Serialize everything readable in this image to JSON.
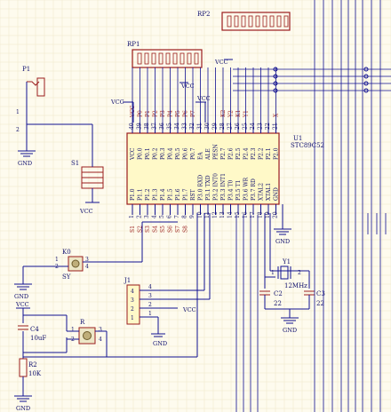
{
  "labels": {
    "rp2": "RP2",
    "rp1": "RP1",
    "vcc_rp1": "VCC",
    "vcc_rp2": "VCC",
    "vcc_u1_left": "VCC",
    "vcc_u1_top": "VCC",
    "vcc_s1": "VCC",
    "vcc_c4": "VCC",
    "vcc_j1": "VCC",
    "p1": "P1",
    "gnd_p1": "GND",
    "s1": "S1",
    "u1_ref": "U1",
    "u1_part": "STC89C52",
    "gnd_u1": "GND",
    "k0": "K0",
    "k0_val": "SY",
    "gnd_k0": "GND",
    "j1": "J1",
    "gnd_j1": "GND",
    "c4": "C4",
    "c4_val": "10uF",
    "r_ref": "R",
    "r2": "R2",
    "r2_val": "10K",
    "gnd_r2": "GND",
    "y1": "Y1",
    "y1_val": "12MHz",
    "c2": "C2",
    "c2_val": "22",
    "c3": "C3",
    "c3_val": "22",
    "gnd_xtal": "GND"
  },
  "u1_top_pins": [
    {
      "num": "40",
      "name": "VCC"
    },
    {
      "num": "39",
      "name": "P0.0"
    },
    {
      "num": "38",
      "name": "P0.1"
    },
    {
      "num": "37",
      "name": "P0.2"
    },
    {
      "num": "36",
      "name": "P0.3"
    },
    {
      "num": "35",
      "name": "P0.4"
    },
    {
      "num": "34",
      "name": "P0.5"
    },
    {
      "num": "33",
      "name": "P0.6"
    },
    {
      "num": "32",
      "name": "P0.7"
    },
    {
      "num": "31",
      "name": "EA"
    },
    {
      "num": "30",
      "name": "ALE"
    },
    {
      "num": "29",
      "name": "PESN"
    },
    {
      "num": "28",
      "name": "P2.7"
    },
    {
      "num": "27",
      "name": "P2.6"
    },
    {
      "num": "26",
      "name": "P2.5"
    },
    {
      "num": "25",
      "name": "P2.4"
    },
    {
      "num": "24",
      "name": "P2.3"
    },
    {
      "num": "23",
      "name": "P2.2"
    },
    {
      "num": "22",
      "name": "P2.1"
    },
    {
      "num": "21",
      "name": "P2.0"
    }
  ],
  "u1_bottom_pins": [
    {
      "num": "1",
      "name": "P1.0"
    },
    {
      "num": "2",
      "name": "P1.1"
    },
    {
      "num": "3",
      "name": "P1.2"
    },
    {
      "num": "4",
      "name": "P1.3"
    },
    {
      "num": "5",
      "name": "P1.4"
    },
    {
      "num": "6",
      "name": "P1.5"
    },
    {
      "num": "7",
      "name": "P1.6"
    },
    {
      "num": "8",
      "name": "P1.7"
    },
    {
      "num": "9",
      "name": "RST"
    },
    {
      "num": "10",
      "name": "P3.0 RXD"
    },
    {
      "num": "11",
      "name": "P3.1 TXD"
    },
    {
      "num": "12",
      "name": "P3.2 INT0"
    },
    {
      "num": "13",
      "name": "P3.3 INT1"
    },
    {
      "num": "14",
      "name": "P3.4 T0"
    },
    {
      "num": "15",
      "name": "P3.5 T1"
    },
    {
      "num": "16",
      "name": "P3.6 WR"
    },
    {
      "num": "17",
      "name": "P3.7 RD"
    },
    {
      "num": "18",
      "name": "XTAL2"
    },
    {
      "num": "19",
      "name": "XTAL1"
    },
    {
      "num": "20",
      "name": "GND"
    }
  ],
  "net_top": [
    "VCC",
    "P0",
    "P1",
    "P2",
    "P3",
    "P4",
    "P5",
    "P6",
    "P7",
    "",
    "",
    "",
    "K2",
    "Y2",
    "K1",
    "Y1",
    "",
    "",
    "",
    "X"
  ],
  "net_bottom": [
    "S1",
    "S2",
    "S3",
    "S4",
    "S5",
    "S6",
    "S7",
    "S8"
  ],
  "k0_pins": [
    "1",
    "2",
    "3",
    "4"
  ],
  "r_pins": [
    "1",
    "2",
    "3",
    "4"
  ],
  "j1_pins": [
    "4",
    "3",
    "2",
    "1"
  ],
  "j1_wire_nums": [
    "4",
    "3",
    "2",
    "1"
  ],
  "y1_pins": [
    "1",
    "2"
  ]
}
